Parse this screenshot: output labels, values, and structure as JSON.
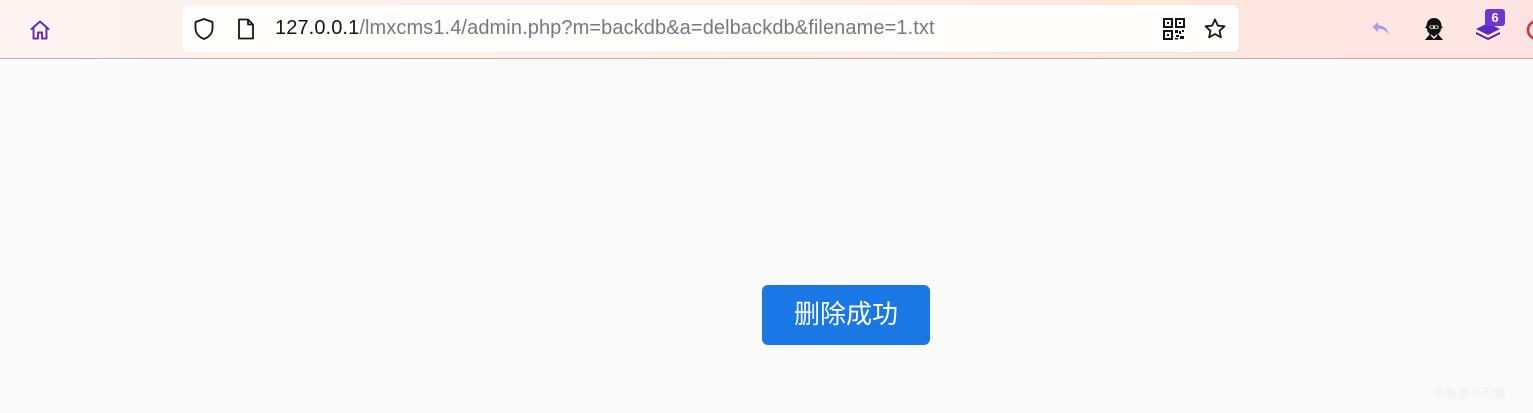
{
  "browser": {
    "url_host": "127.0.0.1",
    "url_path": "/lmxcms1.4/admin.php?m=backdb&a=delbackdb&filename=1.txt",
    "extensions_badge": "6",
    "icons": {
      "home": "home-icon",
      "shield": "tracking-shield-icon",
      "page": "page-info-icon",
      "qr": "qr-code-icon",
      "bookmark": "bookmark-star-icon",
      "undo": "undo-arrow-icon",
      "spy": "spy-extension-icon",
      "stack": "stack-extension-icon"
    },
    "colors": {
      "accent": "#6a38d4",
      "toast_bg": "#1a78e4"
    }
  },
  "page": {
    "message": "删除成功",
    "watermark": "头条@小天锁"
  }
}
